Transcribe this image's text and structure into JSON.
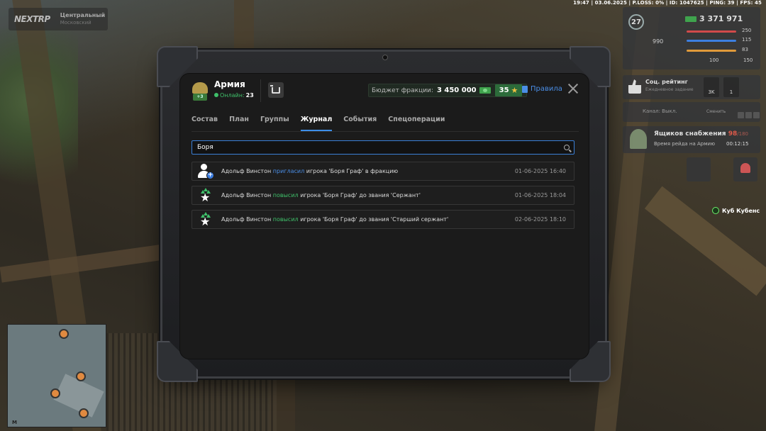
{
  "hud": {
    "top_line": "19:47 | 03.06.2025 | P.LOSS: 0% | ID: 1047625 | PING: 39 | FPS: 45",
    "logo_text": "NEXTRP",
    "location_title": "Центральный",
    "location_sub": "Московский",
    "level": "27",
    "money": "3 371 971",
    "stat_health": "250",
    "stat_armor": "115",
    "stat_food": "83",
    "stat_100": "100",
    "stat_150": "150",
    "stat_990": "990",
    "rating_title": "Соц. рейтинг",
    "rating_sub": "Ежедневное задание",
    "rating_3k": "3K",
    "rating_1": "1",
    "channel_text": "Канал: Выкл.",
    "channel_switch": "Сменить",
    "supply_title": "Ящиков снабжения",
    "supply_count": "98",
    "supply_max": "/180",
    "supply_sub": "Время рейда на Армию",
    "supply_timer": "00:12:15",
    "nearby_player": "Куб Кубенс",
    "minimap_letter": "M"
  },
  "faction": {
    "name": "Армия",
    "online_label": "Онлайн:",
    "online_count": "23",
    "rank_badge": "+3",
    "budget_label": "Бюджет фракции:",
    "budget_value": "3 450 000",
    "stars_value": "35",
    "rules_label": "Правила"
  },
  "tabs": [
    {
      "label": "Состав",
      "active": false
    },
    {
      "label": "План",
      "active": false
    },
    {
      "label": "Группы",
      "active": false
    },
    {
      "label": "Журнал",
      "active": true
    },
    {
      "label": "События",
      "active": false
    },
    {
      "label": "Спецоперации",
      "active": false
    }
  ],
  "search": {
    "value": "Боря"
  },
  "log": [
    {
      "icon": "user-add-icon",
      "actor": "Адольф Винстон",
      "action": "пригласил",
      "rest": "игрока 'Боря Граф' в фракцию",
      "time": "01-06-2025 16:40"
    },
    {
      "icon": "promote-star-icon",
      "actor": "Адольф Винстон",
      "action": "повысил",
      "rest": "игрока 'Боря Граф' до звания 'Сержант'",
      "time": "01-06-2025 18:04"
    },
    {
      "icon": "promote-star-icon",
      "actor": "Адольф Винстон",
      "action": "повысил",
      "rest": "игрока 'Боря Граф' до звания 'Старший сержант'",
      "time": "02-06-2025 18:10"
    }
  ],
  "colors": {
    "accent_blue": "#3d8ee8",
    "invite_blue": "#4a8ee6",
    "promote_green": "#3fc06a",
    "cash_green": "#3fa34d",
    "star_yellow": "#f0c040"
  }
}
